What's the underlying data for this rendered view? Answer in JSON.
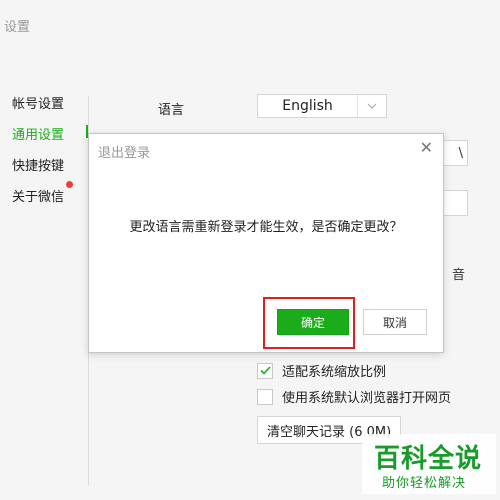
{
  "window": {
    "title": "设置"
  },
  "sidebar": {
    "items": [
      {
        "label": "帐号设置"
      },
      {
        "label": "通用设置"
      },
      {
        "label": "快捷按键"
      },
      {
        "label": "关于微信"
      }
    ]
  },
  "settings": {
    "language_label": "语言",
    "language_value": "English",
    "partial_text_1": "\\",
    "partial_text_2": "音",
    "checkboxes": [
      {
        "label": "适配系统缩放比例",
        "checked": true
      },
      {
        "label": "使用系统默认浏览器打开网页",
        "checked": false
      }
    ],
    "clear_button": "清空聊天记录 (6.0M)"
  },
  "dialog": {
    "title": "退出登录",
    "message": "更改语言需重新登录才能生效，是否确定更改？",
    "confirm": "确定",
    "cancel": "取消"
  },
  "watermark": {
    "title": "百科全说",
    "subtitle": "助你轻松解决"
  },
  "colors": {
    "accent": "#1aad19",
    "highlight": "#e02020",
    "badge": "#f23c3c"
  }
}
